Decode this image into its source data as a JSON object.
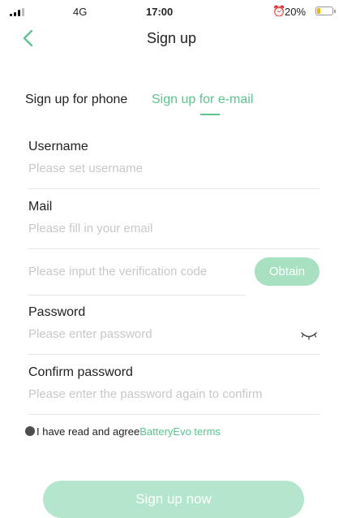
{
  "status_bar": {
    "network": "4G",
    "time": "17:00",
    "battery_percent": "20%",
    "battery_level": 0.2,
    "alarm_icon": "alarm-clock-icon"
  },
  "nav": {
    "title": "Sign up",
    "back_icon": "chevron-left-icon"
  },
  "tabs": [
    {
      "label": "Sign up for phone",
      "active": false
    },
    {
      "label": "Sign up for e-mail",
      "active": true
    }
  ],
  "form": {
    "username": {
      "label": "Username",
      "placeholder": "Please set username",
      "value": ""
    },
    "mail": {
      "label": "Mail",
      "placeholder": "Please fill in your email",
      "value": ""
    },
    "code": {
      "placeholder": "Please input the verification code",
      "value": "",
      "obtain_label": "Obtain"
    },
    "password": {
      "label": "Password",
      "placeholder": "Please enter password",
      "value": "",
      "toggle_icon": "eye-closed-icon"
    },
    "confirm": {
      "label": "Confirm password",
      "placeholder": "Please enter the password again to confirm",
      "value": ""
    }
  },
  "agreement": {
    "text": "I have read and agree",
    "link": "BatteryEvo terms",
    "checked": false
  },
  "submit_label": "Sign up now",
  "colors": {
    "accent": "#5cc48e",
    "button_disabled": "#b3e6cc",
    "placeholder": "#c8c8c8"
  }
}
